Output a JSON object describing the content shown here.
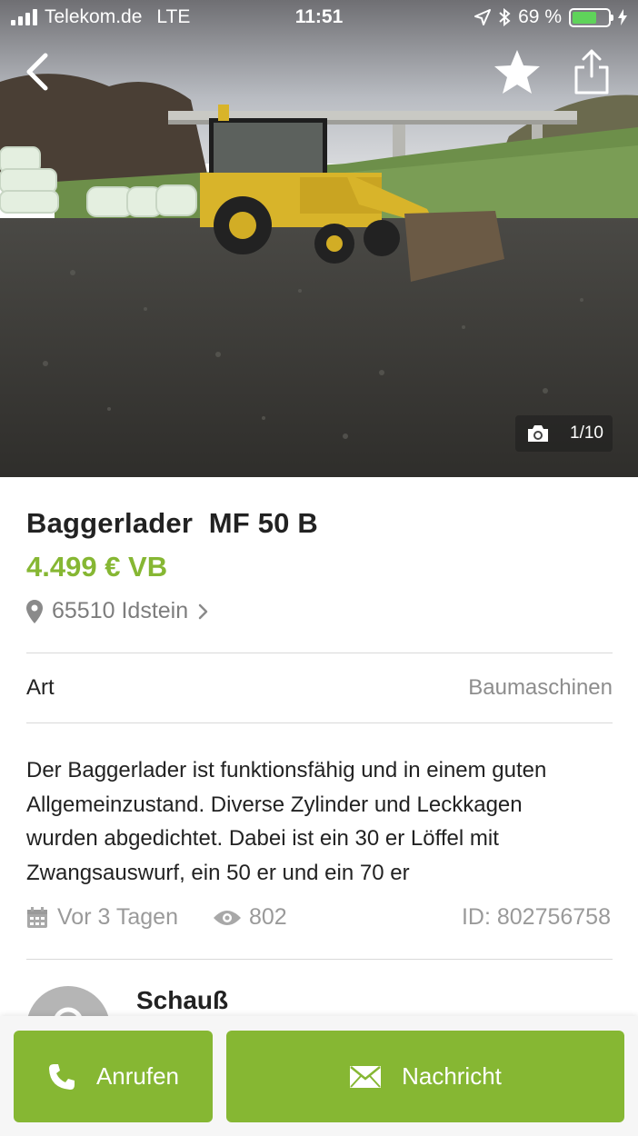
{
  "status_bar": {
    "carrier": "Telekom.de",
    "network": "LTE",
    "time": "11:51",
    "battery": "69 %",
    "battery_level": 0.69
  },
  "gallery": {
    "counter": "1/10"
  },
  "listing": {
    "title": "Baggerlader  MF 50 B",
    "price": "4.499 € VB",
    "location": "65510 Idstein",
    "attribute_key": "Art",
    "attribute_value": "Baumaschinen",
    "description": "Der Baggerlader ist funktionsfähig und in einem guten Allgemeinzustand. Diverse Zylinder und Leckkagen wurden abgedichtet. Dabei ist ein 30 er Löffel mit Zwangsauswurf, ein 50 er und ein 70 er",
    "posted": "Vor 3 Tagen",
    "views": "802",
    "id": "ID: 802756758"
  },
  "seller": {
    "name": "Schauß"
  },
  "actions": {
    "call_label": "Anrufen",
    "message_label": "Nachricht"
  },
  "colors": {
    "accent": "#86b733",
    "text": "#222222",
    "muted": "#8d8d8d",
    "divider": "#d9d9d9"
  },
  "icons": [
    "back-chevron-icon",
    "star-icon",
    "share-icon",
    "camera-icon",
    "location-pin-icon",
    "chevron-right-icon",
    "calendar-icon",
    "eye-icon",
    "phone-icon",
    "envelope-icon"
  ]
}
